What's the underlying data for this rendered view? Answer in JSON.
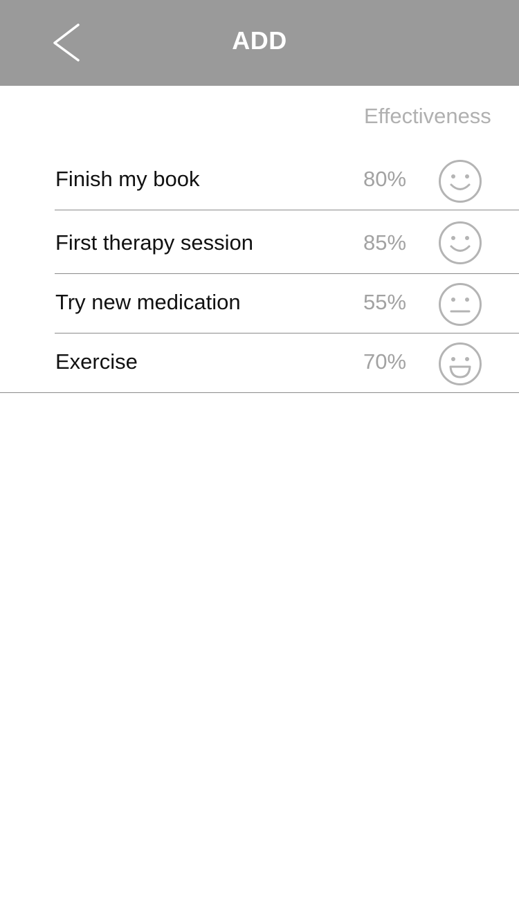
{
  "header": {
    "title": "ADD",
    "back_icon": "chevron-left-icon",
    "background_color": "#9a9a9a"
  },
  "list": {
    "column_header": "Effectiveness",
    "items": [
      {
        "label": "Finish my book",
        "effectiveness": "80%",
        "mood_icon": "smile-face-icon"
      },
      {
        "label": "First therapy session",
        "effectiveness": "85%",
        "mood_icon": "smile-face-icon"
      },
      {
        "label": "Try new medication",
        "effectiveness": "55%",
        "mood_icon": "neutral-face-icon"
      },
      {
        "label": "Exercise",
        "effectiveness": "70%",
        "mood_icon": "grin-face-icon"
      }
    ]
  },
  "colors": {
    "label_text": "#111111",
    "muted_text": "#a2a2a2",
    "icon_stroke": "#b4b4b4",
    "divider": "#8a8a8a"
  }
}
